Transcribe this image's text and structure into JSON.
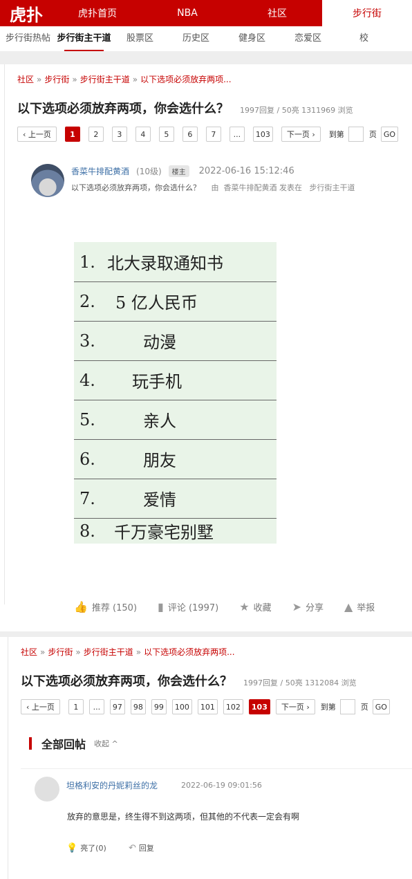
{
  "topbar": {
    "logo": "虎扑",
    "nav": [
      "虎扑首页",
      "NBA",
      "社区",
      "步行街"
    ]
  },
  "subnav": [
    "步行街热帖",
    "步行街主干道",
    "股票区",
    "历史区",
    "健身区",
    "恋爱区",
    "校"
  ],
  "thread": {
    "breadcrumb": [
      "社区",
      "步行街",
      "步行街主干道",
      "以下选项必须放弃两项..."
    ],
    "title": "以下选项必须放弃两项，你会选什么？",
    "stats_top": "1997回复 / 50亮 1311969 浏览",
    "stats_bottom": "1997回复 / 50亮 1312084 浏览"
  },
  "pager_top": {
    "prev": "‹ 上一页",
    "pages": [
      "1",
      "2",
      "3",
      "4",
      "5",
      "6",
      "7",
      "...",
      "103"
    ],
    "next": "下一页 ›",
    "goto_label": "到第",
    "page_label": "页",
    "go": "GO"
  },
  "pager_bottom": {
    "prev": "‹ 上一页",
    "pages": [
      "1",
      "...",
      "97",
      "98",
      "99",
      "100",
      "101",
      "102",
      "103"
    ],
    "next": "下一页 ›",
    "goto_label": "到第",
    "page_label": "页",
    "go": "GO"
  },
  "op": {
    "author": "香菜牛排配黄酒",
    "level": "(10级)",
    "badge": "楼主",
    "date": "2022-06-16 15:12:46",
    "summary": "以下选项必须放弃两项，你会选什么？",
    "posted_by_prefix": "由",
    "posted_by": "香菜牛排配黄酒 发表在",
    "posted_in": "步行街主干道"
  },
  "image_list": [
    {
      "num": "1.",
      "text": "北大录取通知书"
    },
    {
      "num": "2.",
      "text": "5 亿人民币"
    },
    {
      "num": "3.",
      "text": "动漫"
    },
    {
      "num": "4.",
      "text": "玩手机"
    },
    {
      "num": "5.",
      "text": "亲人"
    },
    {
      "num": "6.",
      "text": "朋友"
    },
    {
      "num": "7.",
      "text": "爱情"
    },
    {
      "num": "8.",
      "text": "千万豪宅别墅"
    }
  ],
  "actions": {
    "recommend": "推荐 (150)",
    "comment": "评论 (1997)",
    "favorite": "收藏",
    "share": "分享",
    "report": "举报"
  },
  "replies": {
    "heading": "全部回帖",
    "collapse": "收起 ^",
    "first": {
      "author": "坦格利安的丹妮莉丝的龙",
      "date": "2022-06-19 09:01:56",
      "text": "放弃的意思是，终生得不到这两项，但其他的不代表一定会有啊",
      "light": "亮了(0)",
      "reply": "回复"
    }
  }
}
